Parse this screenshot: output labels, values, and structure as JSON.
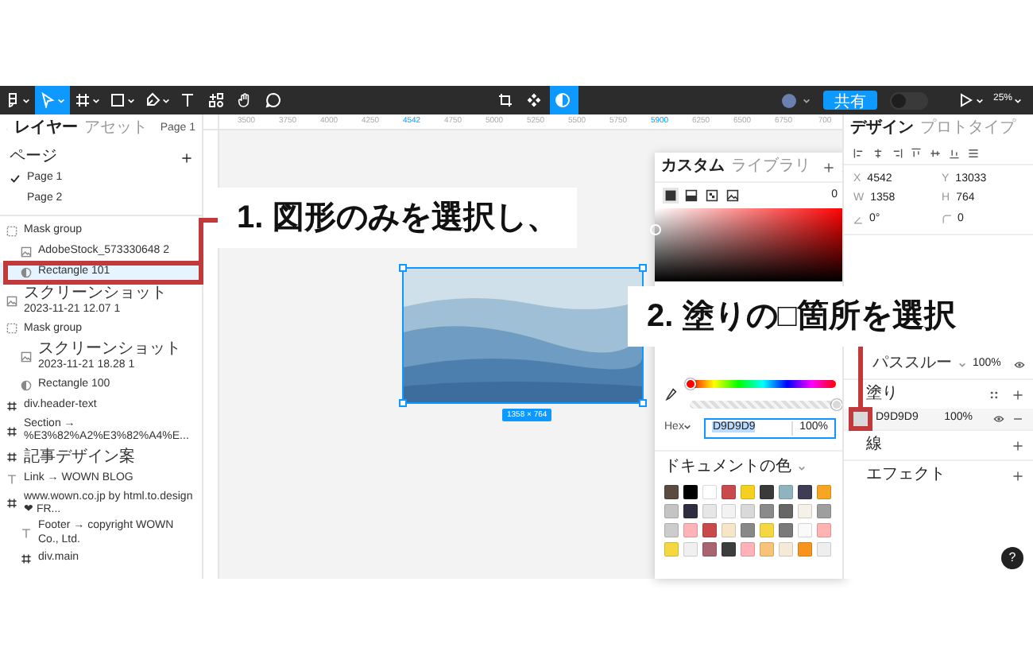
{
  "toolbar": {
    "tools": [
      {
        "kind": "menu",
        "selected": false,
        "dropdown": true
      },
      {
        "kind": "move",
        "selected": true,
        "dropdown": true
      },
      {
        "kind": "frame",
        "selected": false,
        "dropdown": true
      },
      {
        "kind": "rect",
        "selected": false,
        "dropdown": true
      },
      {
        "kind": "pen",
        "selected": false,
        "dropdown": true
      },
      {
        "kind": "text",
        "selected": false,
        "dropdown": false
      },
      {
        "kind": "components",
        "selected": false,
        "dropdown": false
      },
      {
        "kind": "hand",
        "selected": false,
        "dropdown": false
      },
      {
        "kind": "comment",
        "selected": false,
        "dropdown": false
      }
    ],
    "center_tools": [
      {
        "kind": "crop",
        "selected": false
      },
      {
        "kind": "component",
        "selected": false
      },
      {
        "kind": "mask",
        "selected": true
      }
    ],
    "share": "共有",
    "code_toggle": {
      "on": false
    },
    "zoom": "25%"
  },
  "left_panel": {
    "tabs": [
      {
        "label": "レイヤー",
        "selected": true
      },
      {
        "label": "アセット",
        "selected": false
      }
    ],
    "page_menu": "Page 1",
    "pages_title": "ページ",
    "pages": [
      {
        "label": "Page 1",
        "selected": true
      },
      {
        "label": "Page 2",
        "selected": false
      }
    ],
    "layers": [
      {
        "name": "Mask group",
        "kind": "group",
        "selected": false,
        "annotated": false,
        "children": [
          {
            "name": "AdobeStock_573330648 2",
            "kind": "image",
            "selected": false,
            "annotated": false
          },
          {
            "name": "Rectangle 101",
            "kind": "mask",
            "selected": true,
            "annotated": true
          }
        ]
      },
      {
        "name": "スクリーンショット 2023-11-21 12.07 1",
        "kind": "image",
        "selected": false,
        "annotated": false
      },
      {
        "name": "Mask group",
        "kind": "group",
        "selected": false,
        "annotated": false,
        "children": [
          {
            "name": "スクリーンショット 2023-11-21 18.28 1",
            "kind": "image",
            "selected": false,
            "annotated": false
          },
          {
            "name": "Rectangle 100",
            "kind": "mask",
            "selected": false,
            "annotated": false
          }
        ]
      },
      {
        "name": "div.header-text",
        "kind": "frame",
        "selected": false,
        "annotated": false
      },
      {
        "name": "Section → %E3%82%A2%E3%82%A4%E...",
        "kind": "frame",
        "selected": false,
        "annotated": false
      },
      {
        "name": "記事デザイン案",
        "kind": "frame",
        "selected": false,
        "annotated": false
      },
      {
        "name": "Link → WOWN BLOG",
        "kind": "text",
        "selected": false,
        "annotated": false
      },
      {
        "name": "www.wown.co.jp by html.to.design ❤ FR...",
        "kind": "frame",
        "selected": false,
        "annotated": false,
        "children": [
          {
            "name": "Footer → copyright WOWN Co., Ltd.",
            "kind": "text",
            "selected": false,
            "annotated": false
          },
          {
            "name": "div.main",
            "kind": "frame",
            "selected": false,
            "annotated": false
          }
        ]
      }
    ]
  },
  "rulers": {
    "top": [
      {
        "text": "3500",
        "highlighted": false
      },
      {
        "text": "3750",
        "highlighted": false
      },
      {
        "text": "4000",
        "highlighted": false
      },
      {
        "text": "4250",
        "highlighted": false
      },
      {
        "text": "4542",
        "highlighted": true
      },
      {
        "text": "4750",
        "highlighted": false
      },
      {
        "text": "5000",
        "highlighted": false
      },
      {
        "text": "5250",
        "highlighted": false
      },
      {
        "text": "5500",
        "highlighted": false
      },
      {
        "text": "5750",
        "highlighted": false
      },
      {
        "text": "5900",
        "highlighted": true
      },
      {
        "text": "6250",
        "highlighted": false
      },
      {
        "text": "6500",
        "highlighted": false
      },
      {
        "text": "6750",
        "highlighted": false
      },
      {
        "text": "700",
        "highlighted": false
      }
    ]
  },
  "canvas": {
    "size_label": "1358 × 764"
  },
  "color_picker": {
    "tabs": [
      {
        "label": "カスタム",
        "selected": true
      },
      {
        "label": "ライブラリ",
        "selected": false
      }
    ],
    "fill_types": [
      {
        "kind": "solid",
        "selected": true
      },
      {
        "kind": "gradient",
        "selected": false
      },
      {
        "kind": "pattern",
        "selected": false
      },
      {
        "kind": "image",
        "selected": false
      }
    ],
    "count": "0",
    "hue": {
      "level": 0
    },
    "opacity": {
      "level": 1
    },
    "hex": {
      "label": "Hex",
      "value": "D9D9D9",
      "selected": true,
      "opacity": "100%"
    },
    "swatches_title": "ドキュメントの色",
    "swatches": [
      {
        "color": "#5b4a3f"
      },
      {
        "color": "#000000"
      },
      {
        "color": "#ffffff"
      },
      {
        "color": "#c94a4a"
      },
      {
        "color": "#f5d020"
      },
      {
        "color": "#3a3a3a"
      },
      {
        "color": "#8fb4c0"
      },
      {
        "color": "#3f3d56"
      },
      {
        "color": "#f5a623"
      },
      {
        "color": "#c4c4c4"
      },
      {
        "color": "#2f2e41"
      },
      {
        "color": "#e6e6e6"
      },
      {
        "color": "#f2f2f2"
      },
      {
        "color": "#d9d9d9"
      },
      {
        "color": "#8a8a8a"
      },
      {
        "color": "#666666"
      },
      {
        "color": "#f5f0e8"
      },
      {
        "color": "#9e9e9e"
      },
      {
        "color": "#cccccc"
      },
      {
        "color": "#ffb3b8"
      },
      {
        "color": "#c94a4a"
      },
      {
        "color": "#f5e6c8"
      },
      {
        "color": "#888888"
      },
      {
        "color": "#f5d742"
      },
      {
        "color": "#7a7a7a"
      },
      {
        "color": "#fafafa"
      },
      {
        "color": "#ffb3b3"
      },
      {
        "color": "#f5d742"
      },
      {
        "color": "#f0f0f0"
      },
      {
        "color": "#a86470"
      },
      {
        "color": "#3d3d3d"
      },
      {
        "color": "#ffb3b8"
      },
      {
        "color": "#f7c27a"
      },
      {
        "color": "#f5ead8"
      },
      {
        "color": "#f7941d"
      },
      {
        "color": "#eeeeee"
      }
    ]
  },
  "right_panel": {
    "tabs": [
      {
        "label": "デザイン",
        "selected": true
      },
      {
        "label": "プロトタイプ",
        "selected": false
      }
    ],
    "fields": [
      {
        "kind": "label",
        "label": "X",
        "value": "4542"
      },
      {
        "kind": "label",
        "label": "Y",
        "value": "13033"
      },
      {
        "kind": "label",
        "label": "W",
        "value": "1358"
      },
      {
        "kind": "label",
        "label": "H",
        "value": "764"
      },
      {
        "kind": "rotation",
        "value": "0°"
      },
      {
        "kind": "corner",
        "value": "0"
      }
    ],
    "blend": "パススルー",
    "layer_opacity": "100%",
    "sections": [
      {
        "title": "塗り",
        "kind": "fill",
        "rows": [
          {
            "color": "#d9d9d9",
            "hex": "D9D9D9",
            "opacity": "100%",
            "annotated": true
          }
        ]
      },
      {
        "title": "線",
        "kind": "plain"
      },
      {
        "title": "エフェクト",
        "kind": "plain"
      }
    ],
    "help": "?"
  },
  "annotations": [
    {
      "text": "1. 図形のみを選択し、"
    },
    {
      "text": "2. 塗りの□箇所を選択"
    }
  ]
}
